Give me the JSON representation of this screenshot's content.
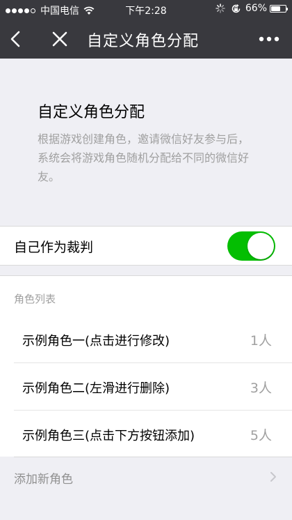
{
  "status_bar": {
    "carrier": "中国电信",
    "time": "下午2:28",
    "battery": "66%",
    "battery_level": 0.66,
    "signal_strength": 4
  },
  "nav": {
    "title": "自定义角色分配",
    "icons": [
      "back-arrow-icon",
      "close-icon",
      "more-icon"
    ]
  },
  "intro": {
    "title": "自定义角色分配",
    "description": "根据游戏创建角色，邀请微信好友参与后，系统会将游戏角色随机分配给不同的微信好友。"
  },
  "referee": {
    "label": "自己作为裁判",
    "enabled": true
  },
  "roles": {
    "header": "角色列表",
    "items": [
      {
        "name": "示例角色一(点击进行修改)",
        "count": "1人"
      },
      {
        "name": "示例角色二(左滑进行删除)",
        "count": "3人"
      },
      {
        "name": "示例角色三(点击下方按钮添加)",
        "count": "5人"
      }
    ]
  },
  "add_role": {
    "label": "添加新角色"
  },
  "colors": {
    "bar_background": "#39393e",
    "page_background": "#efeff4",
    "toggle_on": "#04be02",
    "secondary_text": "#a0a0a0"
  }
}
